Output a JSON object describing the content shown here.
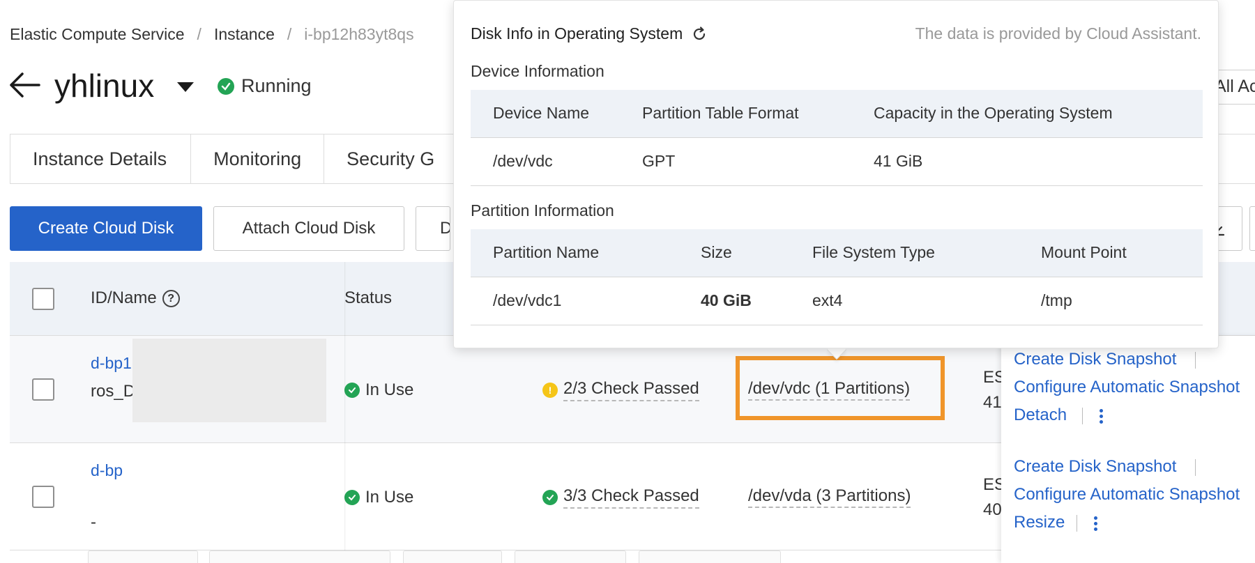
{
  "breadcrumb": {
    "items": [
      "Elastic Compute Service",
      "Instance",
      "i-bp12h83yt8qs"
    ],
    "separator": "/"
  },
  "header": {
    "title": "yhlinux",
    "status": "Running",
    "right_cut_text": "All Ac"
  },
  "tabs": [
    {
      "label": "Instance Details"
    },
    {
      "label": "Monitoring"
    },
    {
      "label": "Security G"
    }
  ],
  "toolbar": {
    "create_label": "Create Cloud Disk",
    "attach_label": "Attach Cloud Disk",
    "third_label": "D"
  },
  "table": {
    "headers": {
      "id_name": "ID/Name",
      "status": "Status"
    },
    "rows": [
      {
        "id": "d-bp1",
        "name": "ros_D",
        "status": "In Use",
        "check": "2/3 Check Passed",
        "device": "/dev/vdc (1 Partitions)",
        "type_cut": "ES",
        "size_cut": "41",
        "ops": [
          "Create Disk Snapshot",
          "Configure Automatic Snapshot",
          "Detach"
        ]
      },
      {
        "id": "d-bp",
        "name": "-",
        "status": "In Use",
        "check": "3/3 Check Passed",
        "device": "/dev/vda (3 Partitions)",
        "type_cut": "ES",
        "size_cut": "40",
        "ops": [
          "Create Disk Snapshot",
          "Configure Automatic Snapshot",
          "Resize"
        ]
      }
    ]
  },
  "popover": {
    "title": "Disk Info in Operating System",
    "note": "The data is provided by Cloud Assistant.",
    "device_section": "Device Information",
    "device_headers": [
      "Device Name",
      "Partition Table Format",
      "Capacity in the Operating System"
    ],
    "device_row": [
      "/dev/vdc",
      "GPT",
      "41 GiB"
    ],
    "partition_section": "Partition Information",
    "partition_headers": [
      "Partition Name",
      "Size",
      "File System Type",
      "Mount Point"
    ],
    "partition_row": [
      "/dev/vdc1",
      "40 GiB",
      "ext4",
      "/tmp"
    ]
  },
  "colors": {
    "primary": "#2563c9",
    "success": "#23a455",
    "warning": "#f5c518",
    "highlight": "#f0952a"
  }
}
